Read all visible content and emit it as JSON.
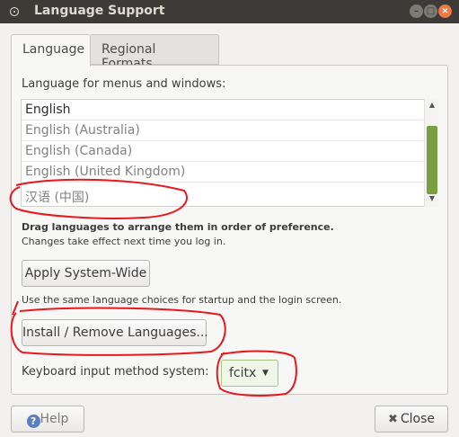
{
  "window": {
    "title": "Language Support",
    "controls": [
      "minimize-icon",
      "maximize-icon",
      "close-icon"
    ]
  },
  "tabs": [
    {
      "label": "Language",
      "active": true
    },
    {
      "label": "Regional Formats",
      "active": false
    }
  ],
  "language_section": {
    "heading": "Language for menus and windows:",
    "languages": [
      "English",
      "English (Australia)",
      "English (Canada)",
      "English (United Kingdom)",
      "汉语 (中国)"
    ],
    "drag_hint": "Drag languages to arrange them in order of preference.",
    "change_hint": "Changes take effect next time you log in.",
    "apply_button": "Apply System-Wide",
    "apply_hint": "Use the same language choices for startup and the login screen.",
    "install_button": "Install / Remove Languages...",
    "keyboard_label": "Keyboard input method system:",
    "keyboard_value": "fcitx"
  },
  "footer": {
    "help_label": "Help",
    "close_label": "Close"
  },
  "colors": {
    "titlebar": "#3c3b37",
    "scroll_thumb": "#7a9e42",
    "annotation": "#e8181e"
  }
}
